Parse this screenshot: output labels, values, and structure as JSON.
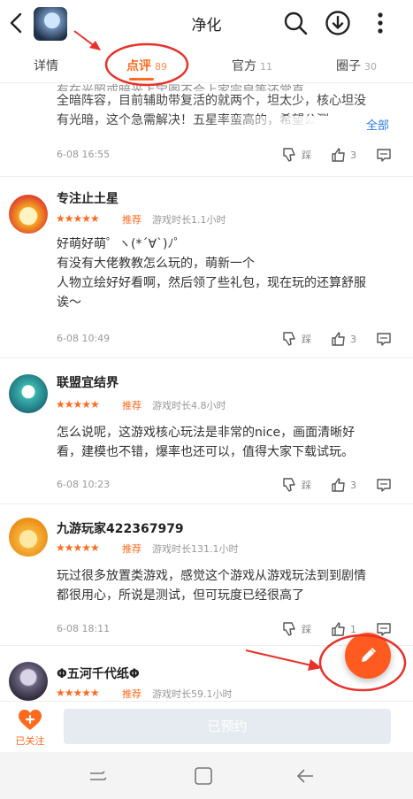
{
  "header": {
    "title": "净化",
    "icons": [
      "back-arrow-icon",
      "search-icon",
      "download-icon",
      "more-vertical-icon"
    ]
  },
  "tabs": [
    {
      "label": "详情",
      "count": ""
    },
    {
      "label": "点评",
      "count": "89"
    },
    {
      "label": "官方",
      "count": "11"
    },
    {
      "label": "圈子",
      "count": "30"
    }
  ],
  "top_review": {
    "text_line1": "全暗阵容，目前辅助带复活的就两个，坦太少，核心坦没",
    "text_line2": "有光暗，这个急需解决！五星率蛮高的，希望公测",
    "more": "全部",
    "date": "6-08 16:55",
    "step_label": "踩",
    "likes": "3"
  },
  "reviews": [
    {
      "username": "专注止土星",
      "stars": "★★★★★",
      "badge": "推荐",
      "playtime": "游戏时长1.1小时",
      "lines": [
        "好萌好萌゜ヽ(*´∀`)ﾉ゜",
        "有没有大佬教教怎么玩的，萌新一个",
        "人物立绘好好看啊，然后领了些礼包，现在玩的还算舒服",
        "诶～"
      ],
      "date": "6-08 10:49",
      "step_label": "踩",
      "likes": "3"
    },
    {
      "username": "联盟宜结界",
      "stars": "★★★★★",
      "badge": "推荐",
      "playtime": "游戏时长4.8小时",
      "lines": [
        "怎么说呢，这游戏核心玩法是非常的nice，画面清晰好",
        "看，建模也不错，爆率也还可以，值得大家下载试玩。"
      ],
      "date": "6-08 10:23",
      "step_label": "踩",
      "likes": "3"
    },
    {
      "username": "九游玩家422367979",
      "stars": "★★★★★",
      "badge": "推荐",
      "playtime": "游戏时长131.1小时",
      "lines": [
        "玩过很多放置类游戏，感觉这个游戏从游戏玩法到到剧情",
        "都很用心，所说是测试，但可玩度已经很高了"
      ],
      "date": "6-08 18:11",
      "step_label": "踩",
      "likes": "1"
    },
    {
      "username": "Φ五河千代纸Φ",
      "stars": "★★★★★",
      "badge": "推荐",
      "playtime": "游戏时长59.1小时"
    }
  ],
  "bottom": {
    "follow_label": "已关注",
    "reserve_label": "已预约"
  },
  "colors": {
    "accent": "#ff6a1f",
    "annotation": "#e8312a",
    "link": "#2a7ae2"
  }
}
